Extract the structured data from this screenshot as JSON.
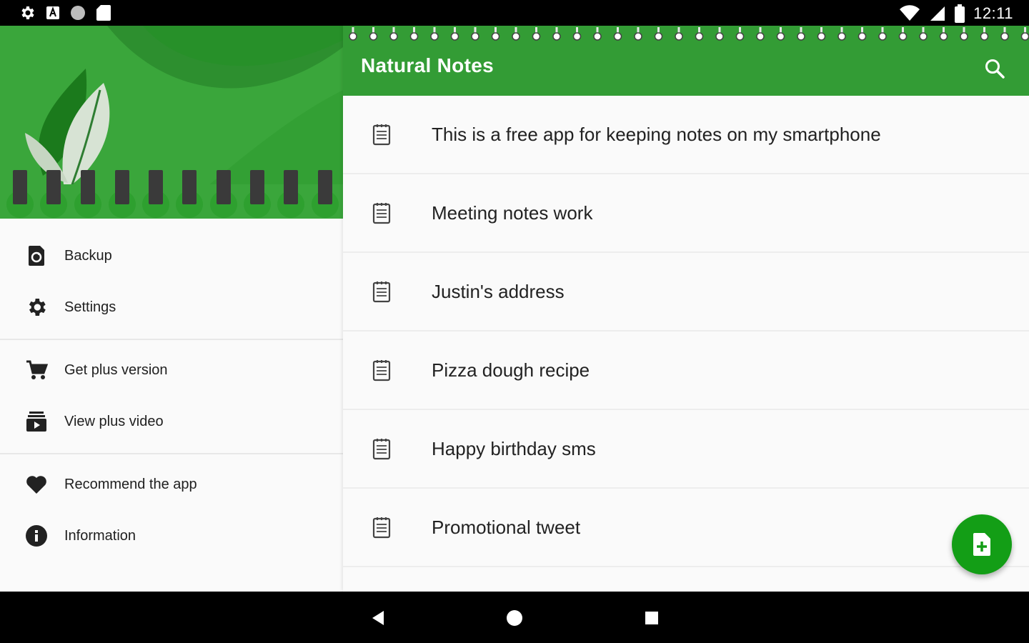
{
  "status_bar": {
    "time": "12:11",
    "icons": [
      "settings-icon",
      "a-badge-icon",
      "circle-icon",
      "sd-card-icon",
      "wifi-icon",
      "cell-signal-icon",
      "battery-icon"
    ]
  },
  "app_bar": {
    "title": "Natural Notes",
    "search_icon": "search-icon"
  },
  "drawer": {
    "groups": [
      [
        {
          "label": "Backup",
          "icon": "backup-icon"
        },
        {
          "label": "Settings",
          "icon": "gear-icon"
        }
      ],
      [
        {
          "label": "Get plus version",
          "icon": "cart-icon"
        },
        {
          "label": "View plus video",
          "icon": "video-icon"
        }
      ],
      [
        {
          "label": "Recommend the app",
          "icon": "heart-icon"
        },
        {
          "label": "Information",
          "icon": "info-icon"
        }
      ]
    ]
  },
  "notes": [
    {
      "title": "This is a free app for keeping notes on my smartphone"
    },
    {
      "title": "Meeting notes work"
    },
    {
      "title": "Justin's address"
    },
    {
      "title": "Pizza dough recipe"
    },
    {
      "title": "Happy birthday sms"
    },
    {
      "title": "Promotional tweet"
    }
  ],
  "fab": {
    "icon": "add-note-icon"
  },
  "nav_bar": {
    "icons": [
      "back-icon",
      "home-icon",
      "recents-icon"
    ]
  },
  "colors": {
    "primary": "#339c35",
    "fab": "#139e16",
    "background": "#fafafa"
  }
}
